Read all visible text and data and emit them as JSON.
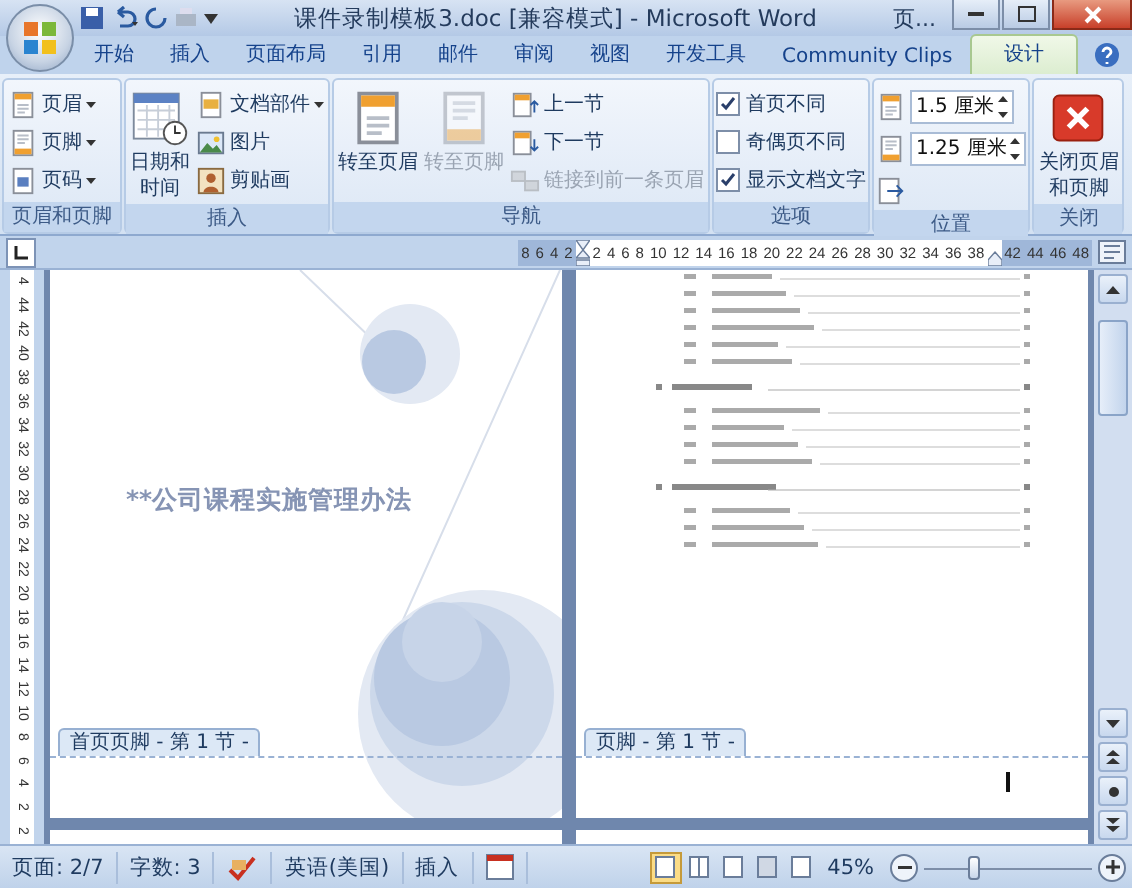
{
  "window": {
    "title": "课件录制模板3.doc [兼容模式] - Microsoft Word",
    "context_tab": "页..."
  },
  "tabs": [
    {
      "label": "开始",
      "selected": false
    },
    {
      "label": "插入",
      "selected": false
    },
    {
      "label": "页面布局",
      "selected": false
    },
    {
      "label": "引用",
      "selected": false
    },
    {
      "label": "邮件",
      "selected": false
    },
    {
      "label": "审阅",
      "selected": false
    },
    {
      "label": "视图",
      "selected": false
    },
    {
      "label": "开发工具",
      "selected": false
    },
    {
      "label": "Community Clips",
      "selected": false
    },
    {
      "label": "设计",
      "selected": true
    }
  ],
  "ribbon": {
    "groups": [
      {
        "label": "页眉和页脚",
        "items": [
          {
            "kind": "small",
            "label": "页眉",
            "dropdown": true,
            "disabled": false
          },
          {
            "kind": "small",
            "label": "页脚",
            "dropdown": true,
            "disabled": false
          },
          {
            "kind": "small",
            "label": "页码",
            "dropdown": true,
            "disabled": false
          }
        ]
      },
      {
        "label": "插入",
        "items": [
          {
            "kind": "large",
            "label": "日期和时间",
            "disabled": false
          },
          {
            "kind": "small",
            "label": "文档部件",
            "dropdown": true,
            "disabled": false
          },
          {
            "kind": "small",
            "label": "图片",
            "dropdown": false,
            "disabled": false
          },
          {
            "kind": "small",
            "label": "剪贴画",
            "dropdown": false,
            "disabled": false
          }
        ]
      },
      {
        "label": "导航",
        "items": [
          {
            "kind": "large",
            "label": "转至页眉",
            "disabled": false
          },
          {
            "kind": "large",
            "label": "转至页脚",
            "disabled": true
          },
          {
            "kind": "small",
            "label": "上一节",
            "dropdown": false,
            "disabled": false
          },
          {
            "kind": "small",
            "label": "下一节",
            "dropdown": false,
            "disabled": false
          },
          {
            "kind": "small",
            "label": "链接到前一条页眉",
            "dropdown": false,
            "disabled": true
          }
        ]
      },
      {
        "label": "选项",
        "items": [
          {
            "kind": "check",
            "label": "首页不同",
            "checked": true
          },
          {
            "kind": "check",
            "label": "奇偶页不同",
            "checked": false
          },
          {
            "kind": "check",
            "label": "显示文档文字",
            "checked": true
          }
        ]
      },
      {
        "label": "位置",
        "items": [
          {
            "kind": "spin",
            "value": "1.5 厘米"
          },
          {
            "kind": "spin",
            "value": "1.25 厘米"
          },
          {
            "kind": "icon"
          }
        ]
      },
      {
        "label": "关闭",
        "items": [
          {
            "kind": "large",
            "label": "关闭页眉和页脚",
            "disabled": false
          }
        ]
      }
    ]
  },
  "ruler": {
    "left_labels": [
      "8",
      "6",
      "4",
      "2"
    ],
    "body_labels": [
      "2",
      "4",
      "6",
      "8",
      "10",
      "12",
      "14",
      "16",
      "18",
      "20",
      "22",
      "24",
      "26",
      "28",
      "30",
      "32",
      "34",
      "36",
      "38"
    ],
    "right_labels": [
      "42",
      "44",
      "46",
      "48"
    ],
    "vertical_labels": [
      "4",
      "44",
      "42",
      "40",
      "38",
      "36",
      "34",
      "32",
      "30",
      "28",
      "26",
      "24",
      "22",
      "20",
      "18",
      "16",
      "14",
      "12",
      "10",
      "8",
      "6",
      "4",
      "2",
      "2"
    ]
  },
  "pages": [
    {
      "title": "**公司课程实施管理办法",
      "footer_tab": "首页页脚 - 第 1 节 -"
    },
    {
      "footer_tab": "页脚 - 第 1 节 -"
    }
  ],
  "status_bar": {
    "items": [
      {
        "kind": "text",
        "text": "页面: 2/7"
      },
      {
        "kind": "text",
        "text": "字数: 3"
      },
      {
        "kind": "proofing"
      },
      {
        "kind": "text",
        "text": "英语(美国)"
      },
      {
        "kind": "text",
        "text": "插入"
      },
      {
        "kind": "macro"
      }
    ],
    "views": [
      {
        "selected": true
      },
      {
        "selected": false
      },
      {
        "selected": false
      },
      {
        "selected": false
      },
      {
        "selected": false
      }
    ],
    "zoom": "45%",
    "zoom_level": {
      "level": 0.3
    }
  }
}
